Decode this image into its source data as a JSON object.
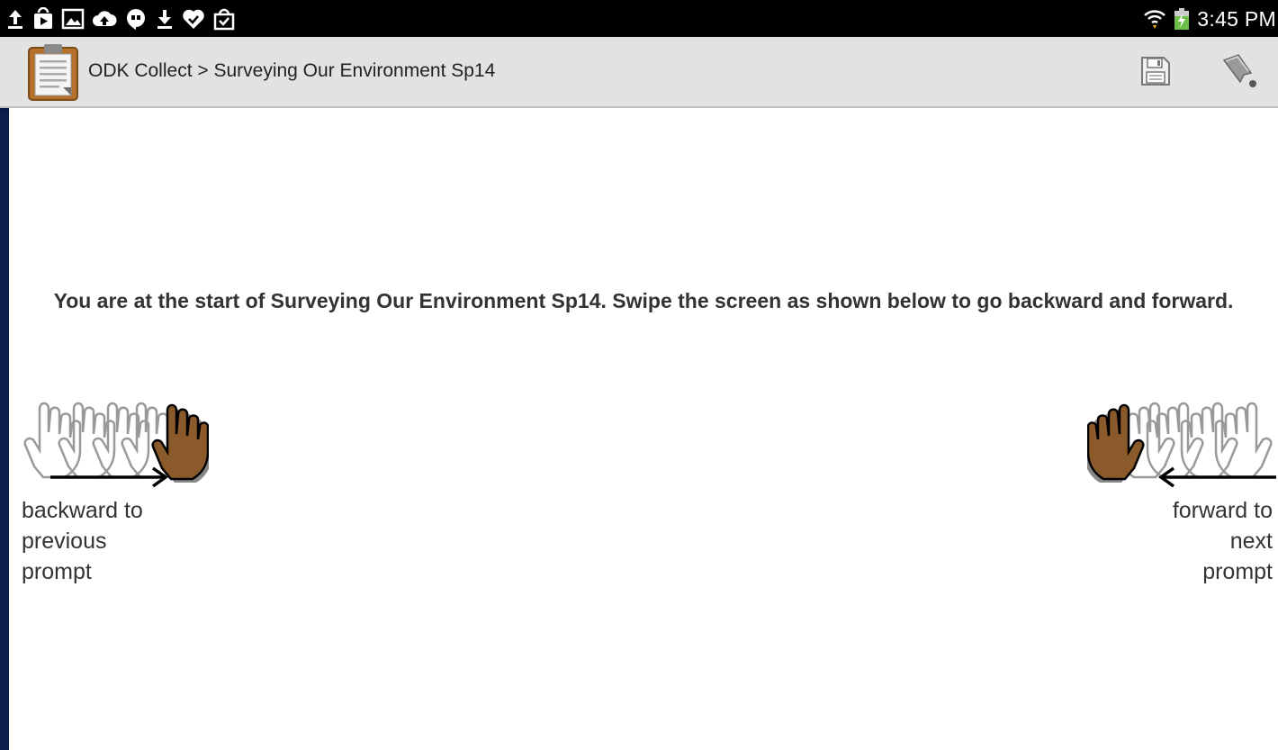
{
  "status_bar": {
    "time": "3:45 PM",
    "left_icons": [
      "upload-icon",
      "play-store-icon",
      "image-icon",
      "cloud-upload-icon",
      "hangouts-icon",
      "download-icon",
      "check-badge-icon",
      "shopping-bag-icon"
    ],
    "right_icons": [
      "wifi-icon",
      "battery-charging-icon"
    ]
  },
  "action_bar": {
    "title": "ODK Collect > Surveying Our Environment Sp14",
    "icons": [
      "clipboard-icon",
      "save-icon",
      "goto-icon"
    ]
  },
  "content": {
    "intro": "You are at the start of Surveying Our Environment Sp14. Swipe the screen as shown below to go backward and forward.",
    "backward_label": [
      "backward to",
      "previous",
      "prompt"
    ],
    "forward_label": [
      "forward to",
      "next",
      "prompt"
    ]
  },
  "colors": {
    "status_bar": "#000000",
    "action_bar": "#e2e2e2",
    "frame": "#0b1f4d",
    "hand_active": "#8b5a2b"
  }
}
